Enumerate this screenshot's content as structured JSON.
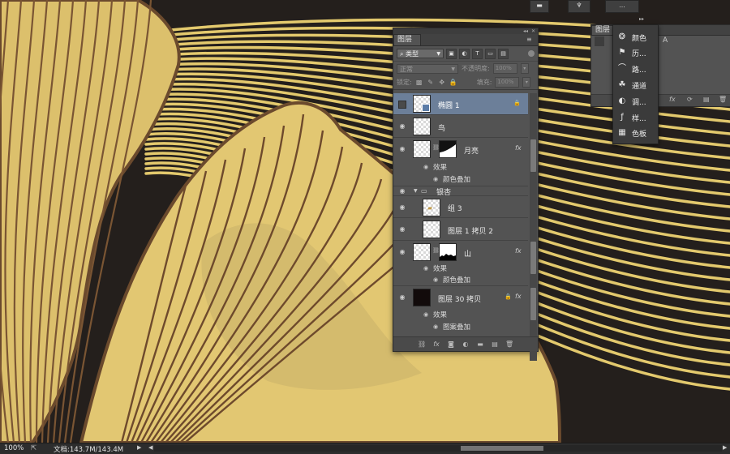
{
  "layers_panel": {
    "tab_label": "图层",
    "filter": {
      "kind_label": "类型",
      "type_icons": [
        "image-filter-icon",
        "adjustment-filter-icon",
        "text-filter-icon",
        "shape-filter-icon",
        "smart-object-filter-icon"
      ]
    },
    "blend_mode": "正常",
    "opacity_label": "不透明度:",
    "opacity_value": "100%",
    "lock_label": "锁定:",
    "fill_label": "填充:",
    "fill_value": "100%",
    "layers": [
      {
        "name": "椭圆 1",
        "selected": true,
        "visible": false,
        "locked": true
      },
      {
        "name": "鸟",
        "visible": true
      },
      {
        "name": "月亮",
        "visible": true,
        "has_mask": true,
        "fx": "fx",
        "effects_label": "效果",
        "effects": [
          "颜色叠加"
        ]
      },
      {
        "name": "银杏",
        "type": "group",
        "expanded": true,
        "visible": true
      },
      {
        "name": "组 3",
        "visible": true,
        "indented": true
      },
      {
        "name": "图层 1 拷贝 2",
        "visible": true,
        "indented": true
      },
      {
        "name": "山",
        "visible": true,
        "has_mask": true,
        "fx": "fx",
        "effects_label": "效果",
        "effects": [
          "颜色叠加"
        ]
      },
      {
        "name": "图层 30 拷贝",
        "visible": true,
        "locked": true,
        "fx": "fx",
        "effects_label": "效果",
        "effects": [
          "图案叠加"
        ]
      }
    ],
    "bottom_icons": [
      "link-layers-icon",
      "fx-icon",
      "add-mask-icon",
      "adjustment-layer-icon",
      "new-group-icon",
      "new-layer-icon",
      "delete-layer-icon"
    ]
  },
  "secondary_panel": {
    "tab_label": "图层",
    "partial_text": "A"
  },
  "dock_menu": {
    "items": [
      {
        "label": "颜色",
        "icon": "color-palette-icon"
      },
      {
        "label": "历...",
        "icon": "history-icon"
      },
      {
        "label": "路...",
        "icon": "paths-icon"
      },
      {
        "label": "通道",
        "icon": "channels-icon"
      },
      {
        "label": "调...",
        "icon": "adjustments-icon"
      },
      {
        "label": "样...",
        "icon": "styles-icon"
      },
      {
        "label": "色板",
        "icon": "swatches-icon"
      }
    ]
  },
  "top_dock": {
    "button_label": "..."
  },
  "status_bar": {
    "zoom": "100%",
    "doc_info": "文档:143.7M/143.4M"
  },
  "colors": {
    "canvas_bg": "#241f1c",
    "petal": "#e0c470",
    "vein": "#6e4a2c",
    "panel": "#535353",
    "selected_row": "#6c7f99"
  }
}
